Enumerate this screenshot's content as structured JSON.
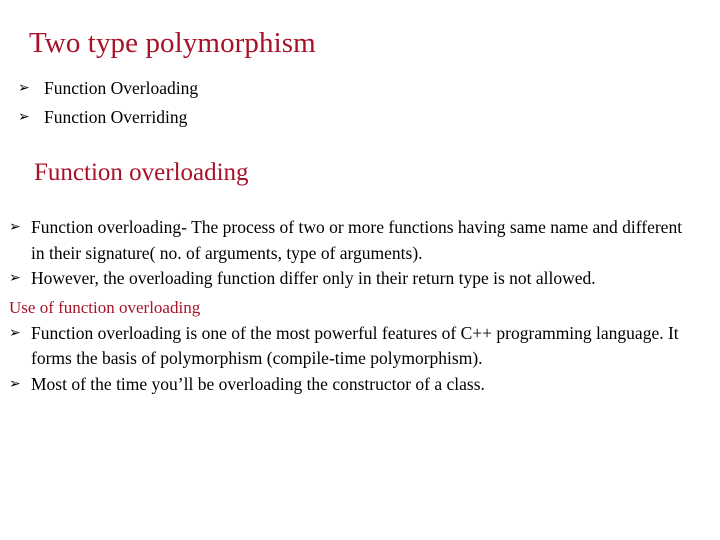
{
  "slide": {
    "title": "Two type polymorphism",
    "bullet_glyph": "➢",
    "accent_color": "#A81228",
    "text_color": "#000000",
    "background_color": "#FFFFFF",
    "top_list": [
      {
        "text": "Function Overloading"
      },
      {
        "text": "Function Overriding"
      }
    ],
    "section_heading": "Function overloading",
    "body_items": [
      {
        "text": "Function overloading- The process of two or more functions having same name and different in their signature( no. of arguments, type of arguments)."
      },
      {
        "text": "However, the overloading function differ only in their return type is not allowed."
      }
    ],
    "red_label": "Use of function overloading",
    "body_items_2": [
      {
        "text": "Function overloading is one of the most powerful features of C++ programming language. It forms the basis of polymorphism (compile-time polymorphism)."
      },
      {
        "text": "Most of the time you’ll be overloading the constructor  of a class."
      }
    ]
  }
}
